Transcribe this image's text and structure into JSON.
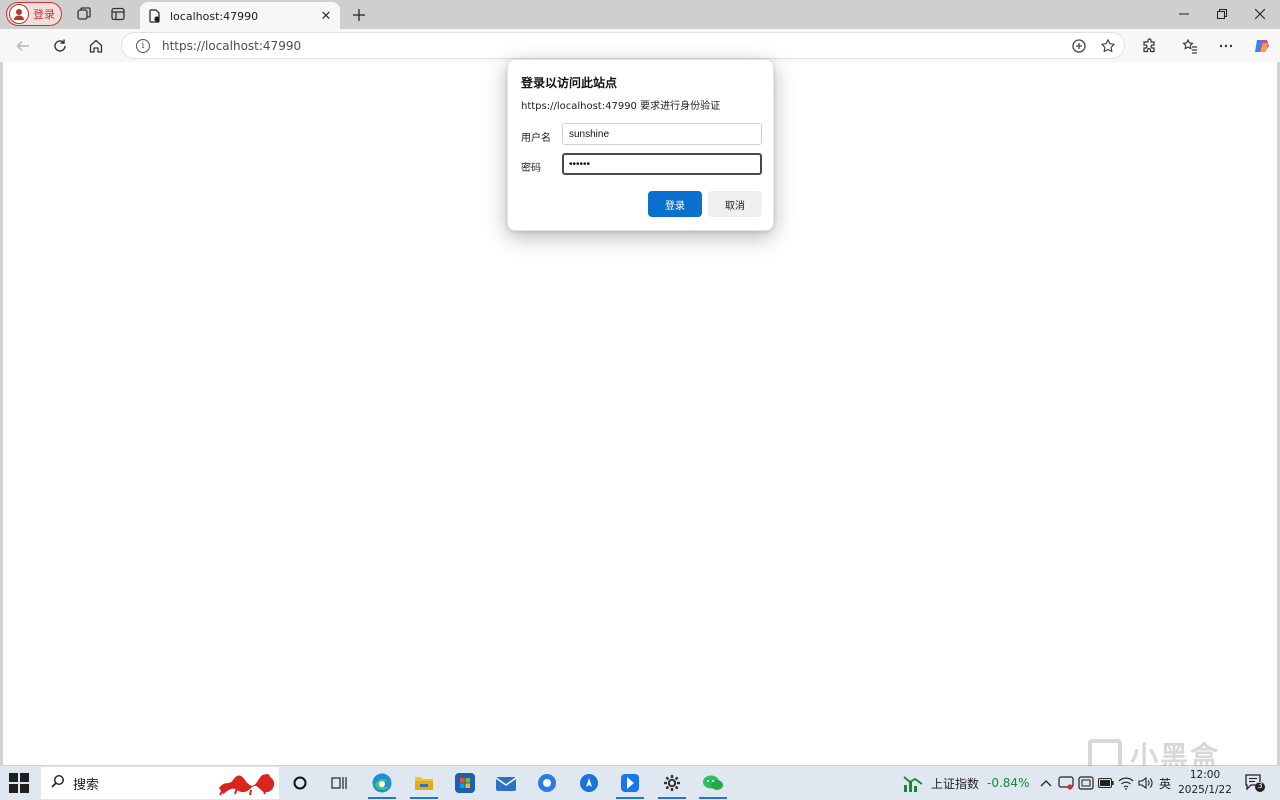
{
  "browser": {
    "profile_label": "登录",
    "tab": {
      "title": "localhost:47990"
    },
    "url": "https://localhost:47990"
  },
  "dialog": {
    "title": "登录以访问此站点",
    "subtitle": "https://localhost:47990 要求进行身份验证",
    "username_label": "用户名",
    "username_value": "sunshine",
    "password_label": "密码",
    "password_masked": "••••••",
    "login_button": "登录",
    "cancel_button": "取消"
  },
  "watermark": {
    "text": "小黑盒"
  },
  "taskbar": {
    "search_placeholder": "搜索",
    "stock_name": "上证指数",
    "stock_change": "-0.84%",
    "ime_label": "英",
    "time": "12:00",
    "date": "2025/1/22",
    "notification_count": "3"
  },
  "colors": {
    "accent": "#0b6fce",
    "profile": "#c0392b",
    "stock_change": "#17893a"
  },
  "icons": [
    "profile-avatar-icon",
    "workspaces-icon",
    "tab-actions-icon",
    "page-favicon-icon",
    "close-icon",
    "plus-icon",
    "minimize-icon",
    "restore-icon",
    "back-icon",
    "refresh-icon",
    "home-icon",
    "info-icon",
    "translate-icon",
    "star-icon",
    "extensions-icon",
    "favorites-icon",
    "more-icon",
    "copilot-icon",
    "windows-start-icon",
    "search-icon",
    "cortana-icon",
    "task-view-icon",
    "edge-icon",
    "file-explorer-icon",
    "store-icon",
    "mail-icon",
    "app-icon",
    "bell-icon"
  ]
}
